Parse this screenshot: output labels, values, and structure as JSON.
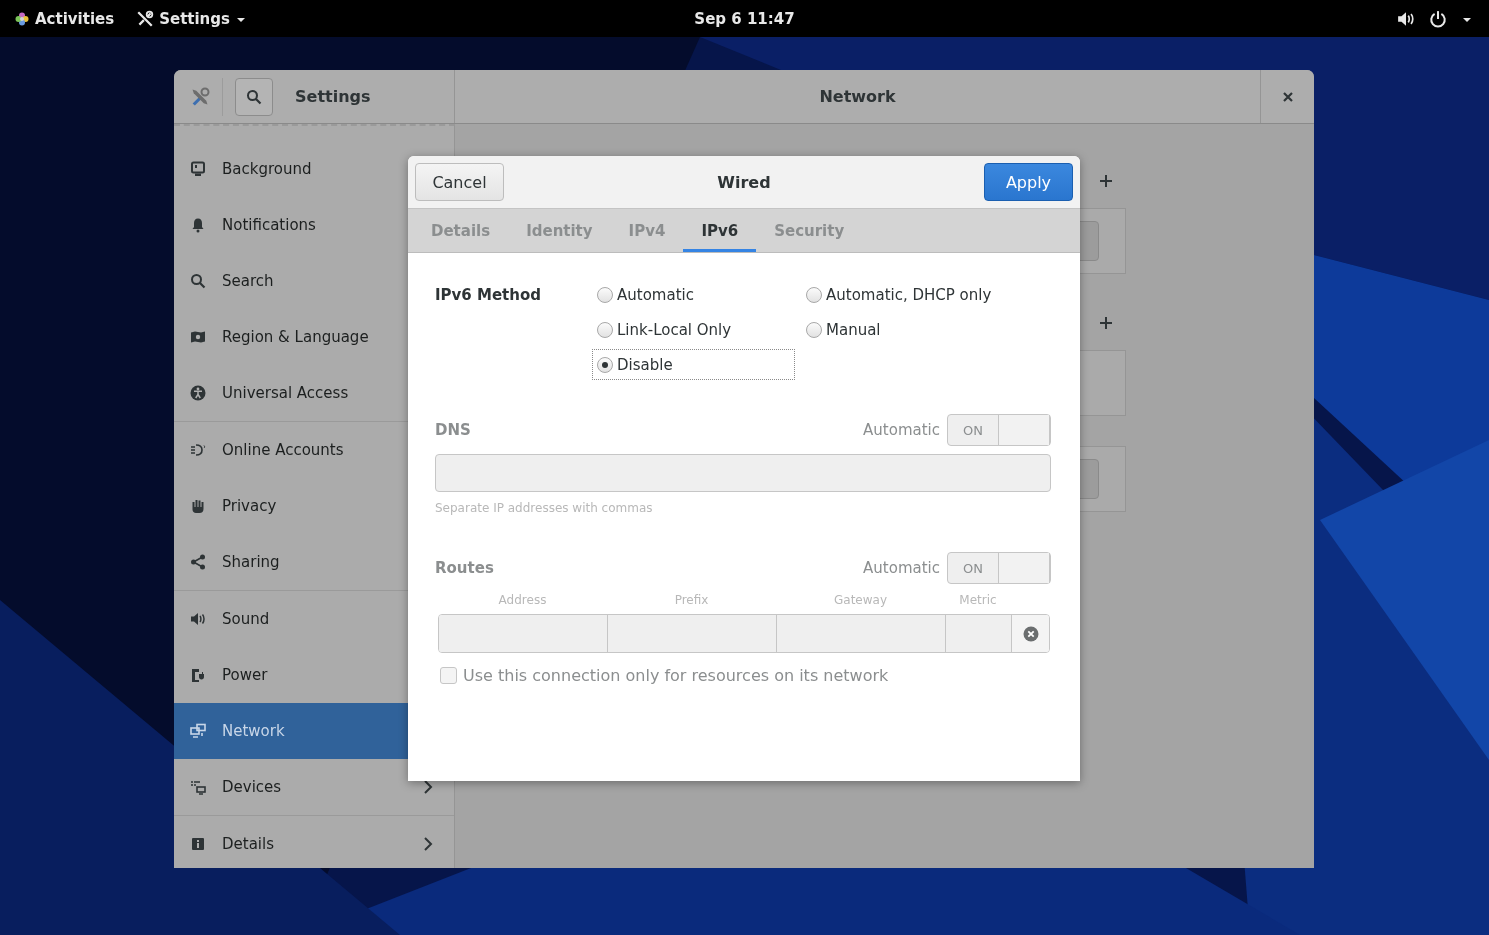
{
  "top_bar": {
    "activities": "Activities",
    "app_menu": "Settings",
    "clock": "Sep 6 11:47"
  },
  "window": {
    "title": "Settings",
    "page_title": "Network"
  },
  "sidebar": {
    "groups": [
      {
        "items": [
          {
            "label": "Background",
            "selected": false,
            "has_submenu": false
          },
          {
            "label": "Notifications",
            "selected": false,
            "has_submenu": false
          },
          {
            "label": "Search",
            "selected": false,
            "has_submenu": false
          },
          {
            "label": "Region & Language",
            "selected": false,
            "has_submenu": false
          },
          {
            "label": "Universal Access",
            "selected": false,
            "has_submenu": false
          }
        ]
      },
      {
        "items": [
          {
            "label": "Online Accounts",
            "selected": false,
            "has_submenu": false
          },
          {
            "label": "Privacy",
            "selected": false,
            "has_submenu": false
          },
          {
            "label": "Sharing",
            "selected": false,
            "has_submenu": false
          }
        ]
      },
      {
        "items": [
          {
            "label": "Sound",
            "selected": false,
            "has_submenu": false
          },
          {
            "label": "Power",
            "selected": false,
            "has_submenu": false
          },
          {
            "label": "Network",
            "selected": true,
            "has_submenu": false
          },
          {
            "label": "Devices",
            "selected": false,
            "has_submenu": true
          }
        ]
      },
      {
        "items": [
          {
            "label": "Details",
            "selected": false,
            "has_submenu": true
          }
        ]
      }
    ]
  },
  "dialog": {
    "title": "Wired",
    "cancel": "Cancel",
    "apply": "Apply",
    "tabs": [
      {
        "label": "Details",
        "selected": false
      },
      {
        "label": "Identity",
        "selected": false
      },
      {
        "label": "IPv4",
        "selected": false
      },
      {
        "label": "IPv6",
        "selected": true
      },
      {
        "label": "Security",
        "selected": false
      }
    ],
    "method": {
      "label": "IPv6 Method",
      "options": [
        {
          "label": "Automatic",
          "selected": false
        },
        {
          "label": "Automatic, DHCP only",
          "selected": false
        },
        {
          "label": "Link-Local Only",
          "selected": false
        },
        {
          "label": "Manual",
          "selected": false
        },
        {
          "label": "Disable",
          "selected": true
        }
      ]
    },
    "dns": {
      "label": "DNS",
      "disabled": true,
      "auto": {
        "label": "Automatic",
        "switch_text": "ON",
        "on": true
      },
      "hint": "Separate IP addresses with commas"
    },
    "routes": {
      "label": "Routes",
      "disabled": true,
      "auto": {
        "label": "Automatic",
        "switch_text": "ON",
        "on": true
      },
      "columns": [
        "Address",
        "Prefix",
        "Gateway",
        "Metric"
      ],
      "only_local": {
        "label": "Use this connection only for resources on its network",
        "checked": false
      }
    }
  }
}
